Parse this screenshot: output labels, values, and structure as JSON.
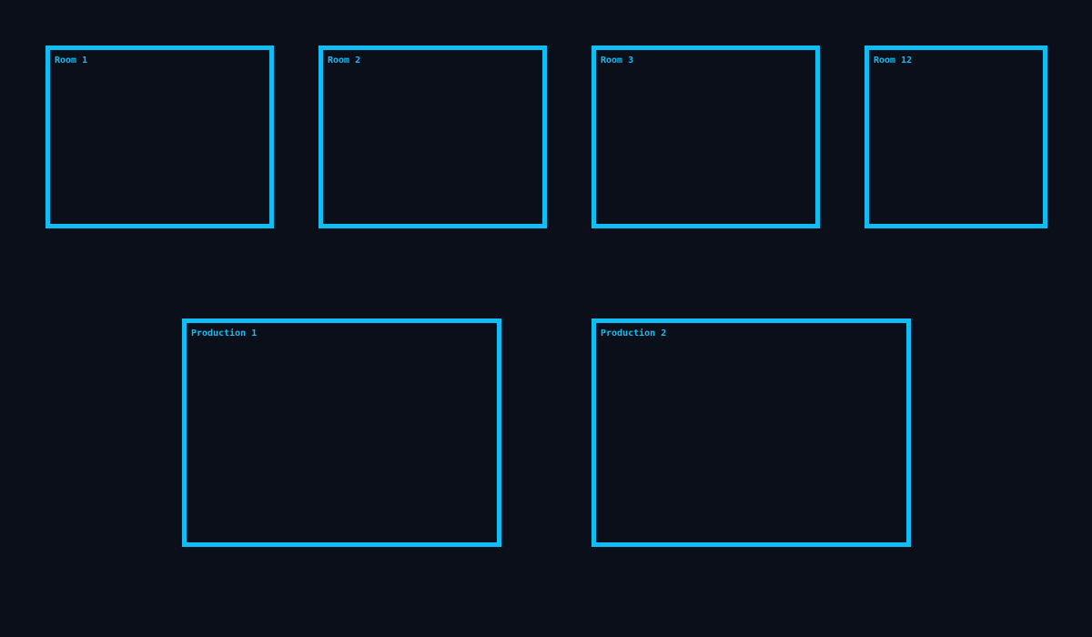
{
  "colors": {
    "background": "#0a0f19",
    "room_border": "#10bef5",
    "label": "#10bef5"
  },
  "rooms": [
    {
      "label": "Room 1"
    },
    {
      "label": "Room 2"
    },
    {
      "label": "Room 3"
    },
    {
      "label": "Room 12"
    },
    {
      "label": "Production 1"
    },
    {
      "label": "Production 2"
    }
  ]
}
